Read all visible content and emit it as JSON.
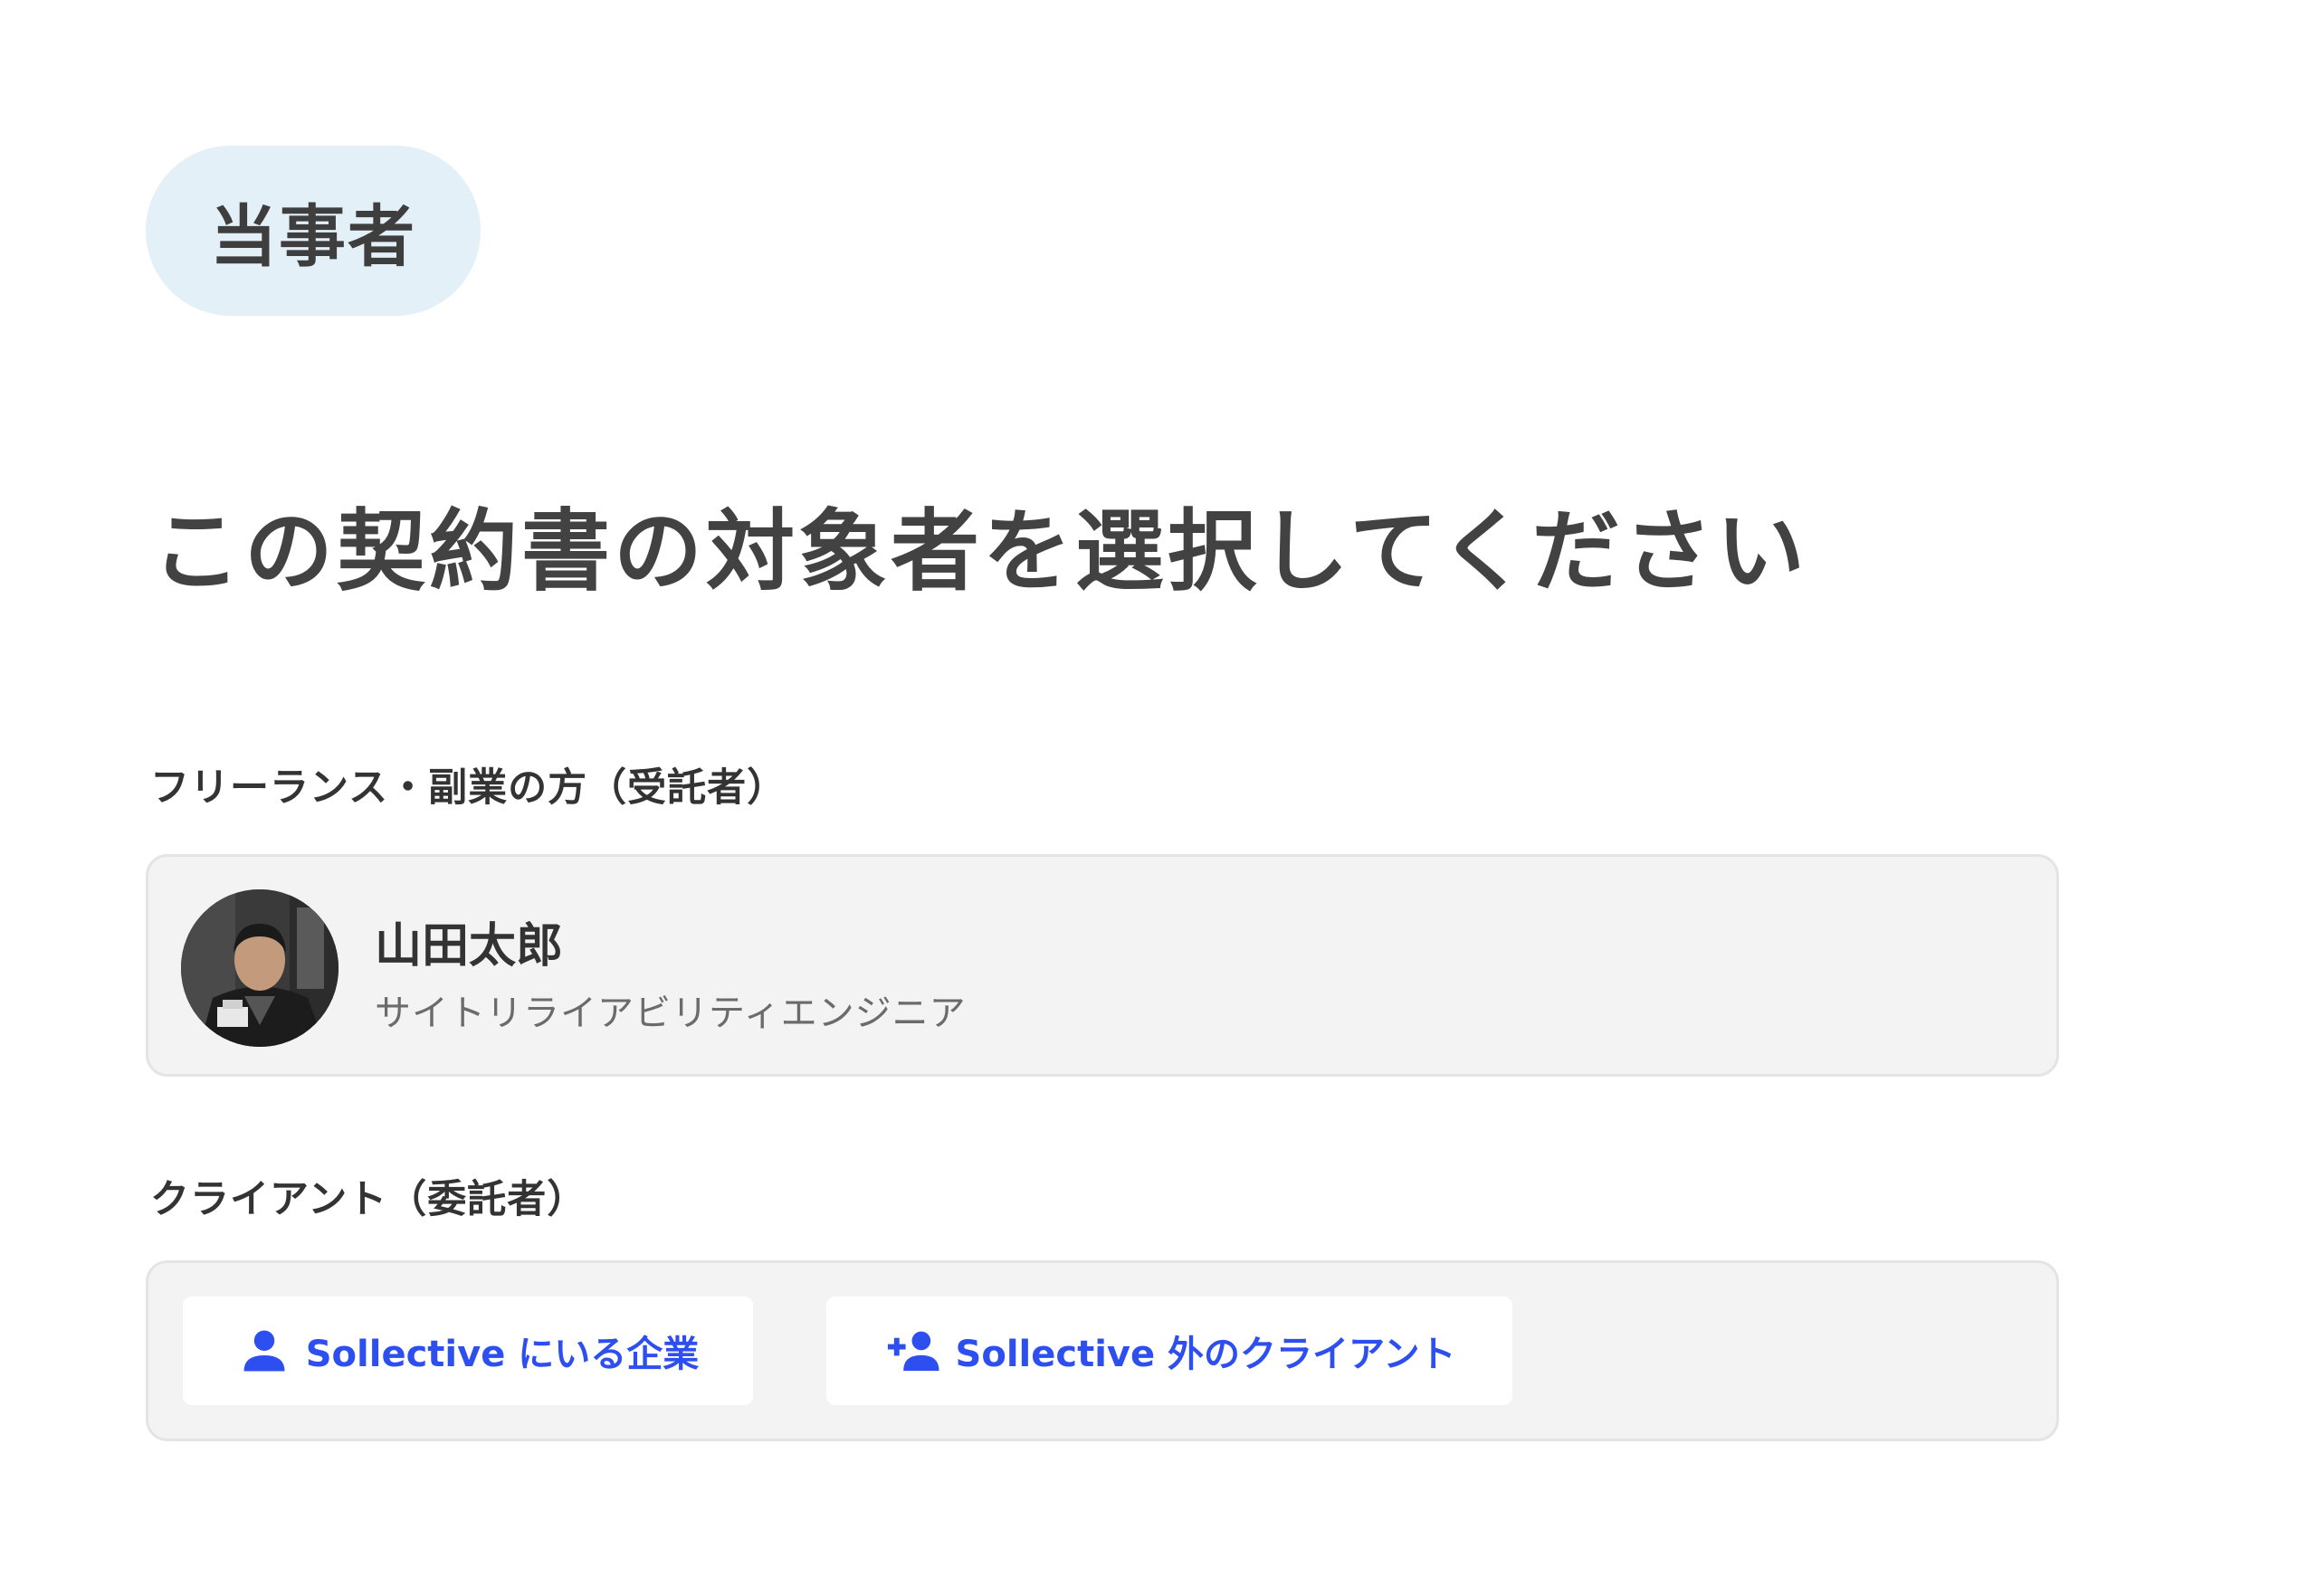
{
  "badge": {
    "label": "当事者"
  },
  "heading": "この契約書の対象者を選択してください",
  "freelancer_section": {
    "label": "フリーランス・副業の方（受託者）",
    "person": {
      "name": "山田太郎",
      "title": "サイトリライアビリティエンジニア",
      "avatar_icon": "user-photo"
    }
  },
  "client_section": {
    "label": "クライアント（委託者）",
    "options": [
      {
        "label": "Sollective にいる企業",
        "icon": "person-icon"
      },
      {
        "label": "Sollective 外のクライアント",
        "icon": "person-add-icon"
      }
    ]
  },
  "colors": {
    "accent": "#2d4ff0",
    "badge_bg": "#e4f0f8",
    "card_bg": "#f2f3f2",
    "card_border": "#e3e4e4"
  }
}
